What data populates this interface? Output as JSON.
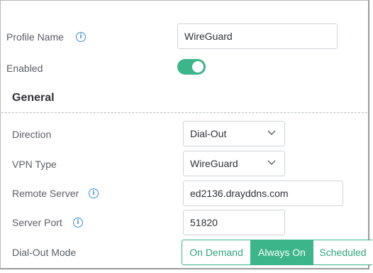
{
  "profile": {
    "name_label": "Profile Name",
    "name_value": "WireGuard",
    "enabled_label": "Enabled",
    "enabled": true
  },
  "general": {
    "title": "General",
    "direction_label": "Direction",
    "direction_value": "Dial-Out",
    "vpn_type_label": "VPN Type",
    "vpn_type_value": "WireGuard",
    "remote_server_label": "Remote Server",
    "remote_server_value": "ed2136.drayddns.com",
    "server_port_label": "Server Port",
    "server_port_value": "51820",
    "dialout_mode_label": "Dial-Out Mode",
    "dialout_modes": [
      "On Demand",
      "Always On",
      "Scheduled"
    ],
    "dialout_mode_selected": "Always On"
  },
  "colors": {
    "accent": "#3db58a",
    "info": "#3d8fd6"
  },
  "icons": {
    "info": "info-icon",
    "dropdown": "chevron-down-icon"
  }
}
